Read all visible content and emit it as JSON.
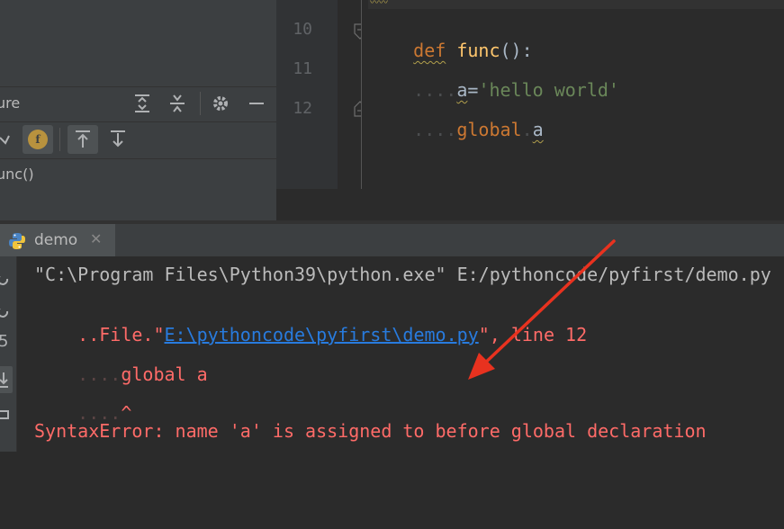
{
  "structure": {
    "title": "ure",
    "tree_item": "unc()",
    "badge_letter": "f"
  },
  "editor": {
    "line_numbers": [
      "10",
      "11",
      "12"
    ],
    "line10": {
      "kw": "def",
      "fn": "func",
      "rest": "():"
    },
    "line11": {
      "dots": "....",
      "var": "a",
      "eq": "=",
      "str": "'hello world'"
    },
    "line12": {
      "dots": "....",
      "kw": "global",
      "dot": ".",
      "var": "a"
    }
  },
  "run": {
    "tab_label": "demo",
    "console": {
      "line1": "\"C:\\Program Files\\Python39\\python.exe\" E:/pythoncode/pyfirst/demo.py",
      "line2_prefix": "..File.\"",
      "line2_link": "E:\\pythoncode\\pyfirst\\demo.py",
      "line2_suffix": "\", line 12",
      "line3_dots": "....",
      "line3_text": "global a",
      "line4_dots": "....",
      "line4_caret": "^",
      "line5": "SyntaxError: name 'a' is assigned to before global declaration"
    }
  },
  "colors": {
    "annotation_arrow": "#e8321f"
  }
}
